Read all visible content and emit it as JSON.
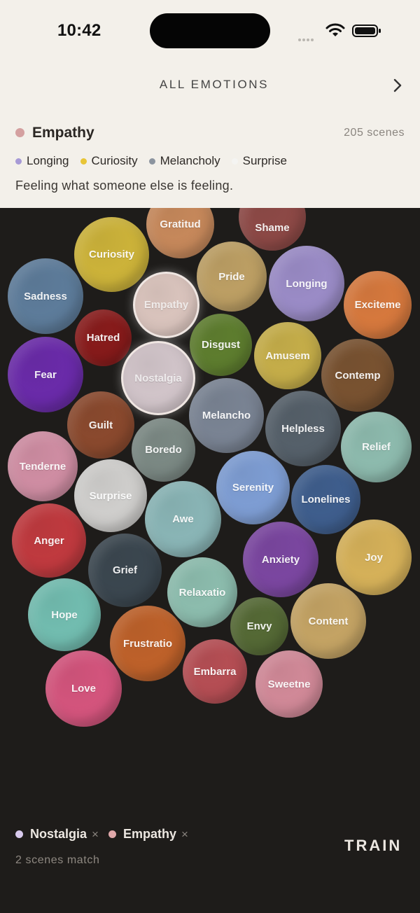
{
  "status_bar": {
    "time": "10:42",
    "icons": [
      "signal-icon",
      "wifi-icon",
      "battery-icon"
    ]
  },
  "nav": {
    "title": "ALL EMOTIONS",
    "chevron_icon": "chevron-right-icon"
  },
  "selected": {
    "name": "Empathy",
    "color": "#d4a0a0",
    "scene_count": "205 scenes",
    "description": "Feeling what someone else is feeling.",
    "related": [
      {
        "label": "Longing",
        "color": "#a79ad6"
      },
      {
        "label": "Curiosity",
        "color": "#e8c536"
      },
      {
        "label": "Melancholy",
        "color": "#8c949f"
      },
      {
        "label": "Surprise",
        "color": "#f4f4f2"
      }
    ]
  },
  "bubbles": [
    {
      "label": "Gratitud",
      "color": "#c98a5c"
    },
    {
      "label": "Shame",
      "color": "#8f4a47"
    },
    {
      "label": "Curiosity",
      "color": "#cfb53a"
    },
    {
      "label": "Pride",
      "color": "#bfa165"
    },
    {
      "label": "Longing",
      "color": "#9c8dc9"
    },
    {
      "label": "Sadness",
      "color": "#5e7d9c"
    },
    {
      "label": "Empathy",
      "color": "#ddc7c0"
    },
    {
      "label": "Exciteme",
      "color": "#d97a3e"
    },
    {
      "label": "Hatred",
      "color": "#8a1b1b"
    },
    {
      "label": "Disgust",
      "color": "#5f7f2f"
    },
    {
      "label": "Amusem",
      "color": "#c8b04a"
    },
    {
      "label": "Fear",
      "color": "#6b2bab"
    },
    {
      "label": "Nostalgia",
      "color": "#d4c7cc"
    },
    {
      "label": "Contemp",
      "color": "#7a5331"
    },
    {
      "label": "Melancho",
      "color": "#7b8595"
    },
    {
      "label": "Guilt",
      "color": "#8c4a2e"
    },
    {
      "label": "Helpless",
      "color": "#56616b"
    },
    {
      "label": "Relief",
      "color": "#8fbdb0"
    },
    {
      "label": "Boredo",
      "color": "#7d8b86"
    },
    {
      "label": "Tenderne",
      "color": "#d28fa5"
    },
    {
      "label": "Serenity",
      "color": "#7f9fd6"
    },
    {
      "label": "Surprise",
      "color": "#d2d1cf"
    },
    {
      "label": "Awe",
      "color": "#8bb7b8"
    },
    {
      "label": "Lonelines",
      "color": "#3f5f8f"
    },
    {
      "label": "Anger",
      "color": "#c23a3f"
    },
    {
      "label": "Joy",
      "color": "#d8b35a"
    },
    {
      "label": "Anxiety",
      "color": "#7c47a2"
    },
    {
      "label": "Grief",
      "color": "#3b4750"
    },
    {
      "label": "Relaxatio",
      "color": "#8ebfb0"
    },
    {
      "label": "Hope",
      "color": "#73bfb2"
    },
    {
      "label": "Content",
      "color": "#c6a565"
    },
    {
      "label": "Envy",
      "color": "#566b36"
    },
    {
      "label": "Frustratio",
      "color": "#c0622a"
    },
    {
      "label": "Embarra",
      "color": "#b84f55"
    },
    {
      "label": "Sweetne",
      "color": "#d48b9a"
    },
    {
      "label": "Love",
      "color": "#d6557e"
    }
  ],
  "filters": [
    {
      "label": "Nostalgia",
      "color": "#d7c9ec",
      "remove": "×"
    },
    {
      "label": "Empathy",
      "color": "#e0a8aa",
      "remove": "×"
    }
  ],
  "match_count": "2 scenes match",
  "train_label": "TRAIN"
}
